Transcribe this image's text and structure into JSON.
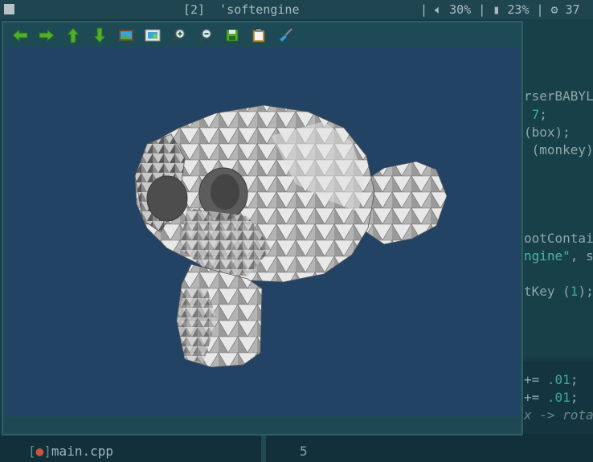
{
  "topbar": {
    "workspace": "[2]",
    "window_title": "softengine",
    "volume": "30%",
    "battery": "23%",
    "cpu": "37"
  },
  "toolbar": {
    "buttons": [
      {
        "name": "back",
        "icon": "arrow-left-icon"
      },
      {
        "name": "forward",
        "icon": "arrow-right-icon"
      },
      {
        "name": "up",
        "icon": "arrow-up-icon"
      },
      {
        "name": "down",
        "icon": "arrow-down-icon"
      },
      {
        "name": "image",
        "icon": "picture-icon"
      },
      {
        "name": "screenshot",
        "icon": "screenshot-icon"
      },
      {
        "name": "zoom-in",
        "icon": "zoom-in-icon"
      },
      {
        "name": "zoom-out",
        "icon": "zoom-out-icon"
      },
      {
        "name": "save",
        "icon": "floppy-icon"
      },
      {
        "name": "paste",
        "icon": "clipboard-icon"
      },
      {
        "name": "clean",
        "icon": "broom-icon"
      }
    ]
  },
  "background_editor": {
    "lines": [
      {
        "text": "rserBABYL"
      },
      {
        "num": "7",
        "rest": ";"
      },
      {
        "italic": "(box);"
      },
      {
        "text": " (monkey)"
      },
      {
        "text": "ootContai"
      },
      {
        "str": "ngine\"",
        "rest": ", s"
      },
      {
        "pre": "tKey (",
        "num": "1",
        "rest": ");"
      }
    ],
    "lower_lines": [
      {
        "pre": "+= ",
        "num": ".01",
        "rest": ";"
      },
      {
        "pre": "+= ",
        "num": ".01",
        "rest": ";"
      },
      {
        "italic": "x -> rota"
      }
    ]
  },
  "filelist": {
    "bracket_open": "[",
    "marker": "●",
    "bracket_close": "]",
    "filename": "main.cpp",
    "line_number": "5"
  },
  "colors": {
    "viewport_bg": "#234365",
    "window_bg": "#1e4a55",
    "arrow_green": "#4caf2f",
    "mesh_light": "#d8d8d8",
    "mesh_dark": "#5a5a5a"
  }
}
